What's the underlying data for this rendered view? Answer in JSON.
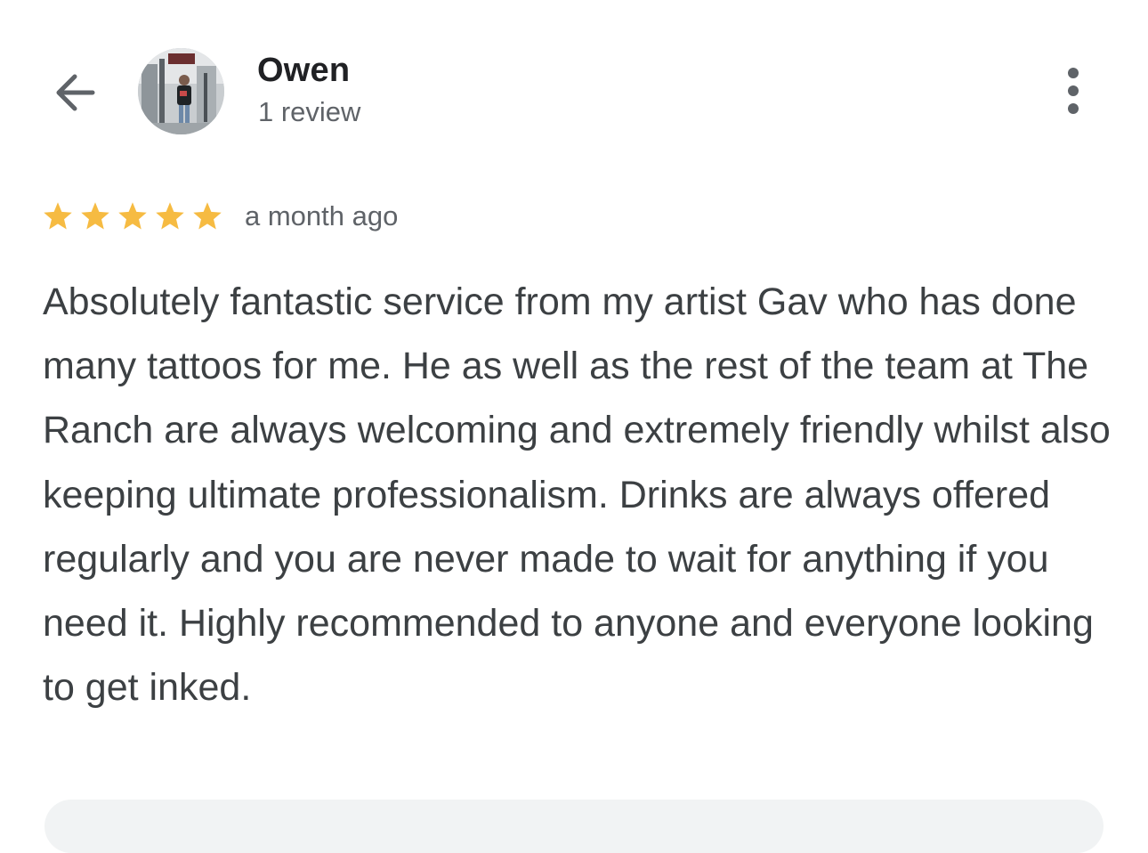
{
  "reviewer": {
    "name": "Owen",
    "review_count": "1 review"
  },
  "review": {
    "rating": 5,
    "rating_max": 5,
    "date": "a month ago",
    "text": "Absolutely fantastic service from my artist Gav who has done many tattoos for me. He as well as the rest of the team at The Ranch are always welcoming and extremely friendly whilst also keeping ultimate professionalism. Drinks are always offered regularly and you are never made to wait for anything if you need it. Highly recommended to anyone and everyone looking to get inked."
  },
  "icons": {
    "back": "arrow-back-icon",
    "more": "more-vertical-icon",
    "star": "star-icon"
  },
  "colors": {
    "star": "#f6bb42",
    "name": "#202124",
    "body_text": "#3c4043",
    "secondary_text": "#5f6368",
    "icon": "#5f6368",
    "card_background": "#f1f3f4"
  }
}
